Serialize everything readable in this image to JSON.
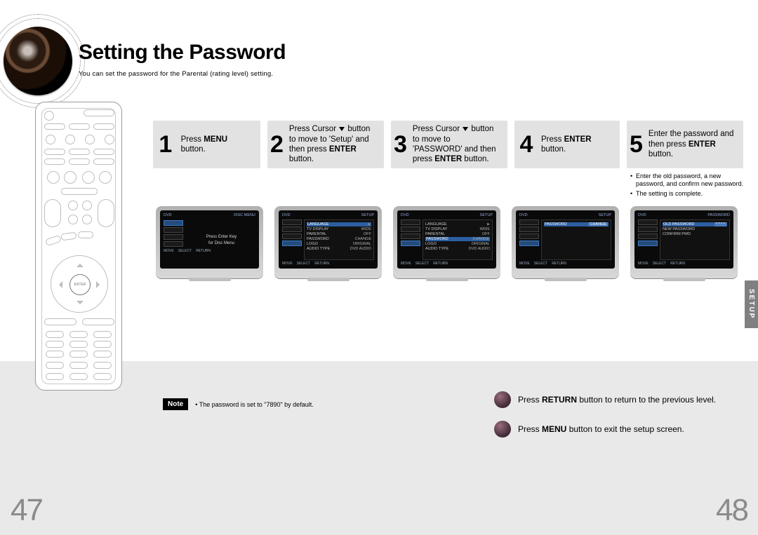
{
  "header": {
    "title": "Setting the Password",
    "subtitle": "You can set the password for the Parental (rating level) setting."
  },
  "pages": {
    "left": "47",
    "right": "48"
  },
  "side_tab": "SETUP",
  "remote": {
    "enter_label": "ENTER"
  },
  "steps": {
    "s1": {
      "num": "1",
      "text_a": "Press ",
      "bold_a": "MENU",
      "text_b": " button."
    },
    "s2": {
      "num": "2",
      "text_a": "Press Cursor ",
      "text_b": " button to move to 'Setup' and then press ",
      "bold_a": "ENTER",
      "text_c": " button."
    },
    "s3": {
      "num": "3",
      "text_a": "Press Cursor ",
      "text_b": " button to move to 'PASSWORD' and then press ",
      "bold_a": "ENTER",
      "text_c": " button."
    },
    "s4": {
      "num": "4",
      "text_a": "Press ",
      "bold_a": "ENTER",
      "text_b": " button."
    },
    "s5": {
      "num": "5",
      "text_a": "Enter the password and then press ",
      "bold_a": "ENTER",
      "text_b": " button."
    }
  },
  "step5_notes": {
    "n1": "Enter the old password, a new password, and confirm new password.",
    "n2": "The setting is complete."
  },
  "note_box": {
    "label": "Note",
    "bullet": "• The password is set to \"7890\" by default."
  },
  "footer": {
    "return": {
      "pre": "Press ",
      "bold": "RETURN",
      "post": " button to return to the previous level."
    },
    "menu": {
      "pre": "Press ",
      "bold": "MENU",
      "post": " button to exit the setup screen."
    }
  },
  "tv1": {
    "title_left": "DVD",
    "title_right": "DISC MENU",
    "center_line1": "Press Enter Key",
    "center_line2": "for Disc Menu"
  },
  "tv_setup_titlebar_left": "DVD",
  "tv_setup_titlebar_right": "SETUP",
  "setup_menu_common": {
    "items": [
      {
        "k": "LANGUAGE",
        "v": "",
        "sel": false
      },
      {
        "k": "TV DISPLAY",
        "v": "WIDE",
        "sel": false
      },
      {
        "k": "PARENTAL",
        "v": "OFF",
        "sel": false
      },
      {
        "k": "PASSWORD",
        "v": "CHANGE",
        "sel": false
      },
      {
        "k": "LOGO",
        "v": "ORIGINAL",
        "sel": false
      },
      {
        "k": "AUDIO TYPE",
        "v": "DVD AUDIO",
        "sel": false
      }
    ]
  },
  "tv4": {
    "row1_k": "PASSWORD",
    "row1_v": "CHANGE"
  },
  "tv5": {
    "titlebar_right": "PASSWORD",
    "rows": [
      {
        "k": "OLD PASSWORD",
        "v": "* * * *"
      },
      {
        "k": "NEW PASSWORD",
        "v": ""
      },
      {
        "k": "CONFIRM PWD",
        "v": ""
      }
    ]
  },
  "bottombar": {
    "b1": "MOVE",
    "b2": "SELECT",
    "b3": "RETURN"
  }
}
